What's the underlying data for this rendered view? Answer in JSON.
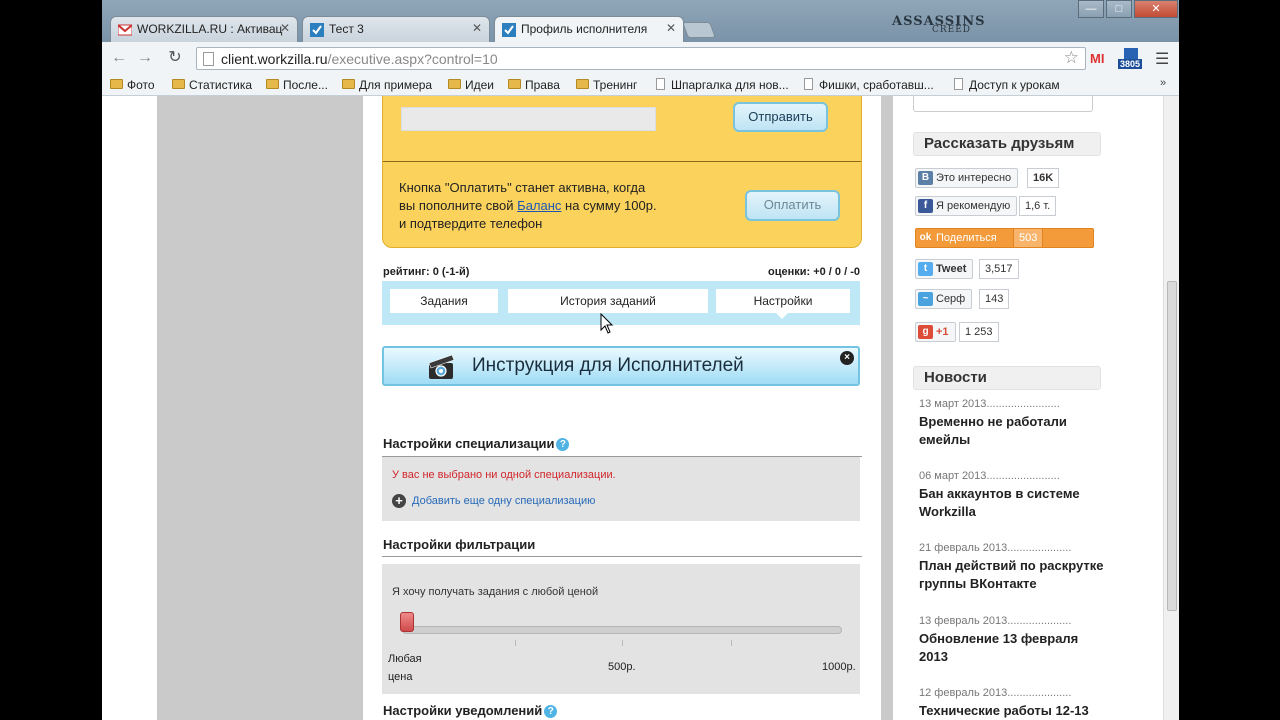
{
  "browser": {
    "tabs": [
      {
        "title": "WORKZILLA.RU : Активац",
        "icon": "gmail-icon"
      },
      {
        "title": "Тест 3",
        "icon": "check-icon"
      },
      {
        "title": "Профиль исполнителя",
        "icon": "check-icon"
      }
    ],
    "theme_logo": "ASSASSINS",
    "theme_logo_sub": "CREED",
    "url_host": "client.workzilla.ru",
    "url_path": "/executive.aspx?control=10",
    "ext_mi": "MI",
    "ext_badge_count": "3805",
    "bookmarks": [
      {
        "label": "Фото",
        "type": "folder"
      },
      {
        "label": "Статистика",
        "type": "folder"
      },
      {
        "label": "После...",
        "type": "folder"
      },
      {
        "label": "Для примера",
        "type": "folder"
      },
      {
        "label": "Идеи",
        "type": "folder"
      },
      {
        "label": "Права",
        "type": "folder"
      },
      {
        "label": "Тренинг",
        "type": "folder"
      },
      {
        "label": "Шпаргалка для нов...",
        "type": "page"
      },
      {
        "label": "Фишки, сработавш...",
        "type": "page"
      },
      {
        "label": "Доступ к урокам",
        "type": "page"
      }
    ],
    "bookmarks_more": "»"
  },
  "profile": {
    "send_button": "Отправить",
    "pay_note_before": "Кнопка \"Оплатить\" станет активна, когда вы пополните свой ",
    "pay_note_link": "Баланс",
    "pay_note_after": " на сумму 100р. и подтвердите телефон",
    "pay_button": "Оплатить",
    "rating": "рейтинг: 0 (-1-й)",
    "scores": "оценки: +0 / 0 / -0",
    "tabs": [
      "Задания",
      "История заданий",
      "Настройки"
    ],
    "banner": "Инструкция для Исполнителей",
    "banner_close": "×",
    "spec_title": "Настройки специализации",
    "spec_empty": "У вас не выбрано ни одной специализации.",
    "spec_add": "Добавить еще одну специализацию",
    "filter_title": "Настройки фильтрации",
    "filter_text": "Я хочу получать задания с любой ценой",
    "slider_value": 0,
    "slider_labels": {
      "min": "Любая цена",
      "mid": "500р.",
      "max": "1000р."
    },
    "notify_title": "Настройки уведомлений",
    "help": "?"
  },
  "sidebar": {
    "share_title": "Рассказать друзьям",
    "social": [
      {
        "name": "vk",
        "icon_text": "В",
        "label": "Это интересно",
        "count": "16K",
        "color": "#5b7fa6"
      },
      {
        "name": "facebook",
        "icon_text": "f",
        "label": "Я рекомендую",
        "count": "1,6 т.",
        "color": "#3b5998"
      },
      {
        "name": "odnoklassniki",
        "icon_text": "ok",
        "label": "Поделиться",
        "count": "503",
        "color": "#f39a3a"
      },
      {
        "name": "twitter",
        "icon_text": "t",
        "label": "Tweet",
        "count": "3,517",
        "color": "#55acee"
      },
      {
        "name": "surfingbird",
        "icon_text": "~",
        "label": "Серф",
        "count": "143",
        "color": "#4aa3df"
      },
      {
        "name": "gplus",
        "icon_text": "g",
        "label": "+1",
        "count": "1 253",
        "color": "#dd4b39"
      }
    ],
    "news_title": "Новости",
    "news": [
      {
        "date": "13 март 2013........................",
        "title": "Временно не работали емейлы"
      },
      {
        "date": "06 март 2013........................",
        "title": "Бан аккаунтов в системе Workzilla"
      },
      {
        "date": "21 февраль 2013.....................",
        "title": "План действий по раскрутке группы ВКонтакте"
      },
      {
        "date": "13 февраль 2013.....................",
        "title": "Обновление 13 февраля 2013"
      },
      {
        "date": "12 февраль 2013.....................",
        "title": "Технические работы 12-13"
      }
    ]
  }
}
